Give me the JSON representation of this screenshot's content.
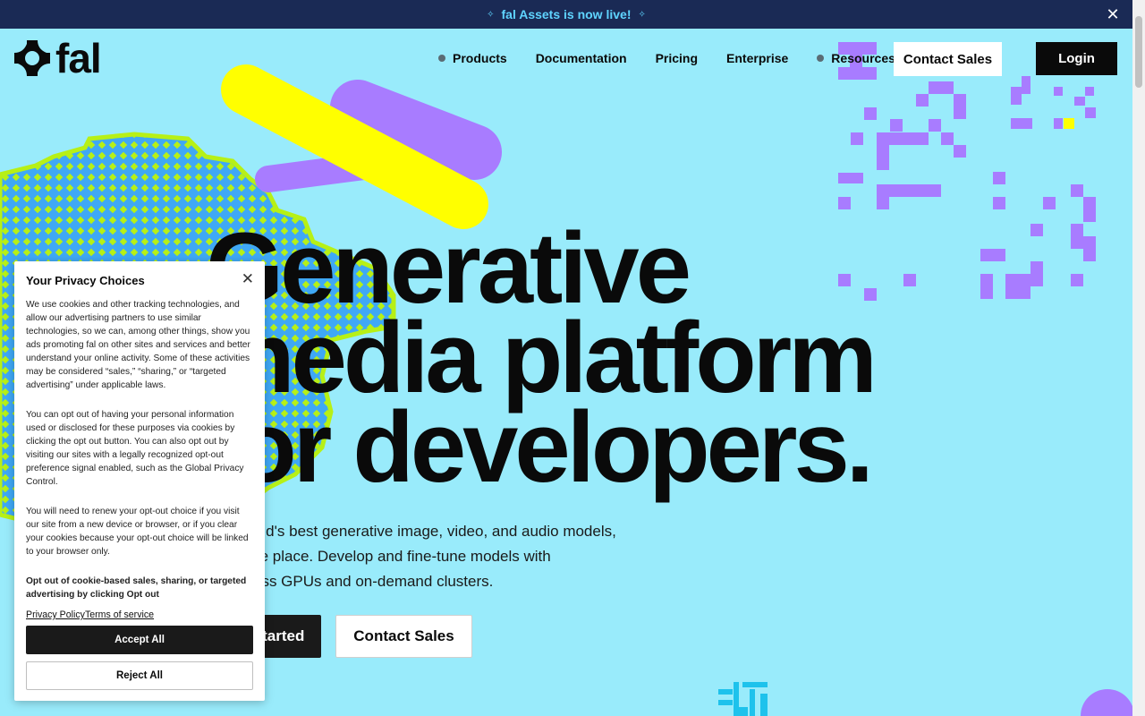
{
  "announcement": {
    "text": "fal Assets is now live!",
    "close_icon": "close-icon"
  },
  "header": {
    "logo_text": "fal",
    "nav": [
      {
        "label": "Products",
        "has_dot": true
      },
      {
        "label": "Documentation",
        "has_dot": false
      },
      {
        "label": "Pricing",
        "has_dot": false
      },
      {
        "label": "Enterprise",
        "has_dot": false
      },
      {
        "label": "Resources",
        "has_dot": true
      }
    ],
    "contact_label": "Contact Sales",
    "login_label": "Login"
  },
  "hero": {
    "title_lines": [
      "Generative",
      "media platform",
      "for developers."
    ],
    "subtitle_lines": [
      "The world's best generative image, video, and audio models,",
      "all in one place. Develop and fine-tune models with",
      "serverless GPUs and on-demand clusters."
    ],
    "primary_label": "Get started",
    "secondary_label": "Contact Sales"
  },
  "privacy": {
    "title": "Your Privacy Choices",
    "paragraph1": "We use cookies and other tracking technologies, and allow our advertising partners to use similar technologies, so we can, among other things, show you ads promoting fal on other sites and services and better understand your online activity. Some of these activities may be considered “sales,” “sharing,” or “targeted advertising” under applicable laws.",
    "paragraph2": "You can opt out of having your personal information used or disclosed for these purposes via cookies by clicking the opt out button. You can also opt out by visiting our sites with a legally recognized opt-out preference signal enabled, such as the Global Privacy Control.",
    "paragraph3": "You will need to renew your opt-out choice if you visit our site from a new device or browser, or if you clear your cookies because your opt-out choice will be linked to your browser only.",
    "paragraph4": "Opt out of cookie-based sales, sharing, or targeted advertising by clicking Opt out",
    "privacy_policy_label": "Privacy Policy",
    "terms_label": "Terms of service",
    "accept_label": "Accept All",
    "reject_label": "Reject All"
  },
  "colors": {
    "background": "#99ebfb",
    "announcement_bg": "#1a2a55",
    "announcement_text": "#5fd4ff",
    "purple": "#a87cff",
    "yellow": "#ffff00",
    "lime": "#b7f016",
    "blue": "#3fa8f5"
  }
}
